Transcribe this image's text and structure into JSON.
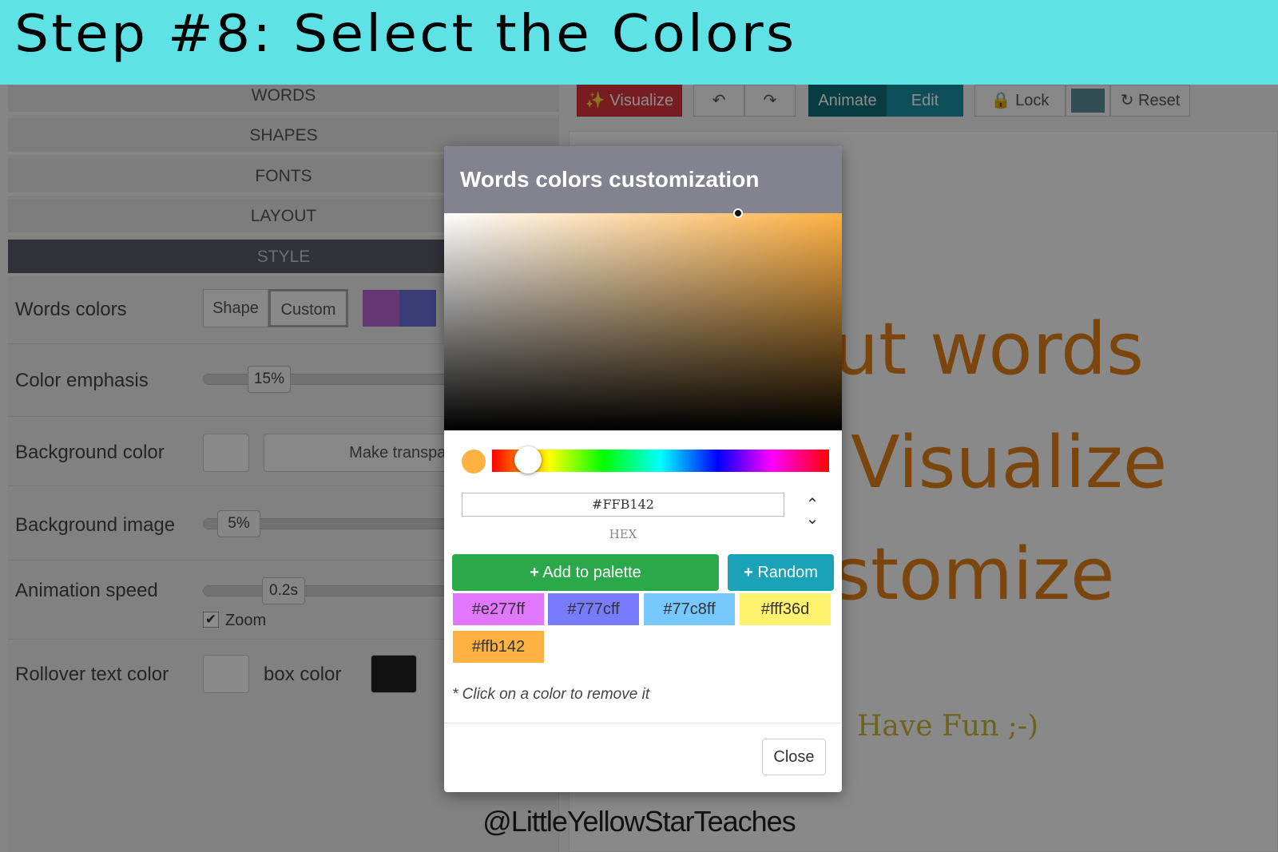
{
  "banner": {
    "title": "Step #8: Select the Colors"
  },
  "sidebar": {
    "sections": [
      "WORDS",
      "SHAPES",
      "FONTS",
      "LAYOUT",
      "STYLE"
    ],
    "active_section": "STYLE"
  },
  "style_panel": {
    "words_colors": {
      "label": "Words colors",
      "shape_btn": "Shape",
      "custom_btn": "Custom"
    },
    "color_emphasis": {
      "label": "Color emphasis",
      "value": "15%"
    },
    "background_color": {
      "label": "Background color",
      "transparent_btn": "Make transparent"
    },
    "background_image": {
      "label": "Background image",
      "value": "5%"
    },
    "animation_speed": {
      "label": "Animation speed",
      "value": "0.2s",
      "zoom_label": "Zoom",
      "zoom_checked": true
    },
    "rollover": {
      "label": "Rollover text color",
      "box_label": "box color"
    }
  },
  "toolbar": {
    "visualize": "Visualize",
    "animate": "Animate",
    "edit": "Edit",
    "lock": "Lock",
    "reset": "Reset"
  },
  "canvas_words": [
    "ut words",
    "Visualize",
    "stomize",
    "Have Fun ;-)"
  ],
  "modal": {
    "title": "Words colors customization",
    "hex_value": "#FFB142",
    "hex_label": "HEX",
    "add_to_palette": "Add to palette",
    "random": "Random",
    "palette": [
      {
        "label": "#e277ff",
        "color": "#e277ff"
      },
      {
        "label": "#777cff",
        "color": "#777cff"
      },
      {
        "label": "#77c8ff",
        "color": "#77c8ff"
      },
      {
        "label": "#fff36d",
        "color": "#fff36d"
      },
      {
        "label": "#ffb142",
        "color": "#ffb142"
      }
    ],
    "remove_note": "* Click on a color to remove it",
    "close": "Close"
  },
  "credit": "@LittleYellowStarTeaches"
}
